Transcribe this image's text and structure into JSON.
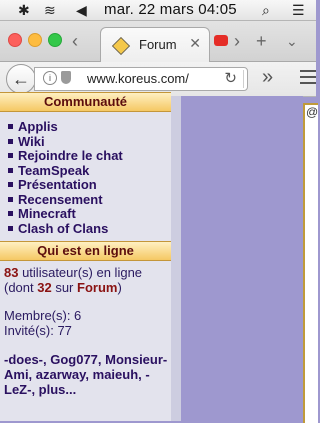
{
  "menubar": {
    "apple": "",
    "bluetooth": "✱",
    "wifi": "≋",
    "volume": "◀",
    "datetime": "mar. 22 mars  04:05",
    "search": "⌕",
    "list": "☰"
  },
  "tabs": [
    {
      "title": "Forum",
      "close": "✕",
      "active": true
    },
    {
      "title": "",
      "active": false
    }
  ],
  "tabbar": {
    "scroll_right": "›",
    "new_tab": "+",
    "menu_caret": "⌄"
  },
  "navbar": {
    "back": "←",
    "info": "i",
    "url": "www.koreus.com/",
    "reload": "↻",
    "overflow": "»"
  },
  "sidebar": {
    "community_title": "Communauté",
    "links": [
      "Applis",
      "Wiki",
      "Rejoindre le chat",
      "TeamSpeak",
      "Présentation",
      "Recensement",
      "Minecraft",
      "Clash of Clans"
    ],
    "online_title": "Qui est en ligne",
    "online_count": "83",
    "online_suffix": " utilisateur(s) en ligne",
    "online_line2_prefix": "(dont ",
    "online_forum_count": "32",
    "online_line2_mid": " sur ",
    "online_forum_link": "Forum",
    "online_line2_suffix": ")",
    "members_label": "Membre(s): 6",
    "guests_label": "Invité(s): 77",
    "members_list": "-does-, Gog077, Monsieur-Ami, azarway, maieuh, -LeZ-, plus..."
  },
  "colors": {
    "page_bg": "#9e98cf",
    "sidebar_bg": "#e3e3ed",
    "section_header": "#f5c864",
    "link_color": "#2a1060",
    "count_color": "#8a1212"
  }
}
